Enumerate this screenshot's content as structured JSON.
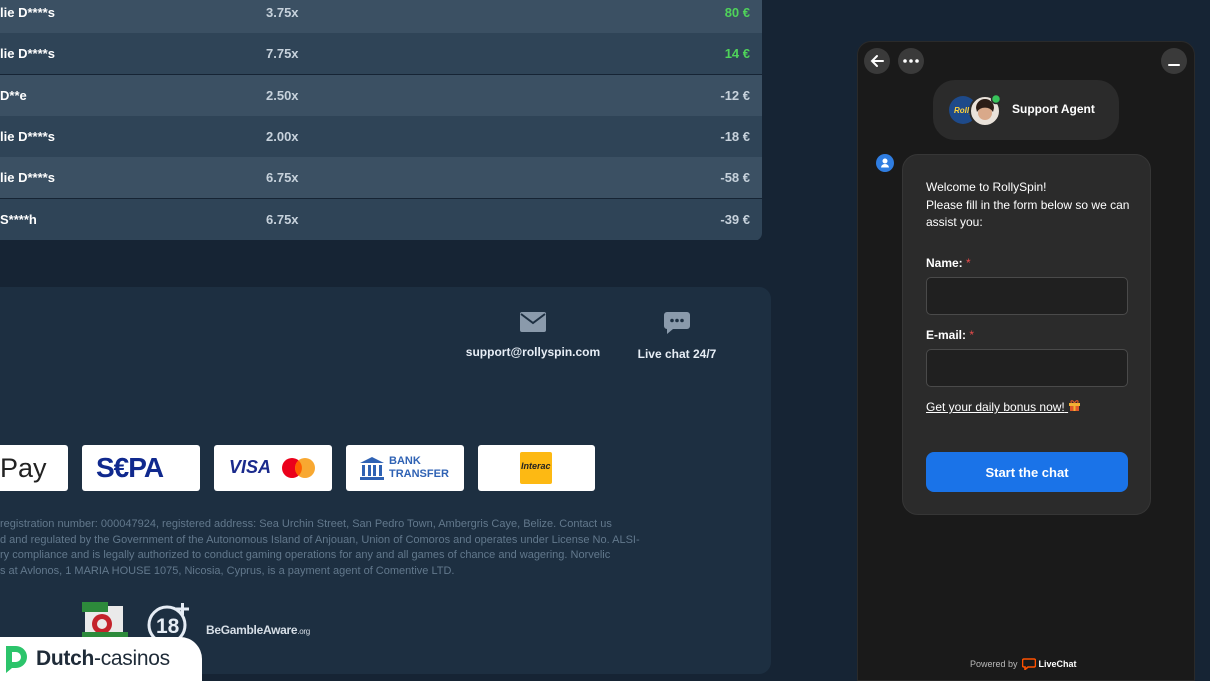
{
  "bets": [
    {
      "player": "lie D****s",
      "multiplier": "3.75x",
      "payout": "80 €",
      "win": true
    },
    {
      "player": "lie D****s",
      "multiplier": "7.75x",
      "payout": "14 €",
      "win": true
    },
    {
      "player": " D**e",
      "multiplier": "2.50x",
      "payout": "-12 €",
      "win": false
    },
    {
      "player": "lie D****s",
      "multiplier": "2.00x",
      "payout": "-18 €",
      "win": false
    },
    {
      "player": "lie D****s",
      "multiplier": "6.75x",
      "payout": "-58 €",
      "win": false
    },
    {
      "player": " S****h",
      "multiplier": "6.75x",
      "payout": "-39 €",
      "win": false
    }
  ],
  "footer": {
    "support_email": "support@rollyspin.com",
    "live_chat": "Live chat 24/7",
    "payments": {
      "pay": "Pay",
      "sepa": "S€PA",
      "visa": "VISA",
      "bank_line1": "BANK",
      "bank_line2": "TRANSFER",
      "interac": "Interac"
    },
    "legal": "registration number: 000047924, registered address: Sea Urchin Street, San Pedro Town, Ambergris Caye, Belize. Contact us\nd and regulated by the Government of the Autonomous Island of Anjouan, Union of Comoros and operates under License No. ALSI-\nry compliance and is legally authorized to conduct gaming operations for any and all games of chance and wagering. Norvelic\ns at Avlonos, 1 MARIA HOUSE 1075, Nicosia, Cyprus, is a payment agent of Comentive LTD.",
    "age_badge": "18+",
    "begambleaware": "BeGambleAware",
    "begambleaware_org": ".org"
  },
  "watermark": {
    "brand_bold": "Dutch",
    "brand_rest": "-casinos"
  },
  "chat": {
    "agent_name": "Support Agent",
    "welcome": "Welcome to RollySpin!\nPlease fill in the form below so we can assist you:",
    "name_label": "Name:",
    "email_label": "E-mail:",
    "required_mark": "*",
    "name_value": "",
    "email_value": "",
    "bonus_link": "Get your daily bonus now!",
    "start_button": "Start the chat",
    "powered_by": "Powered by",
    "livechat": "LiveChat"
  },
  "colors": {
    "background": "#162434",
    "win": "#4fd35a",
    "chat_button": "#1a73e8",
    "required": "#e94b4b"
  }
}
